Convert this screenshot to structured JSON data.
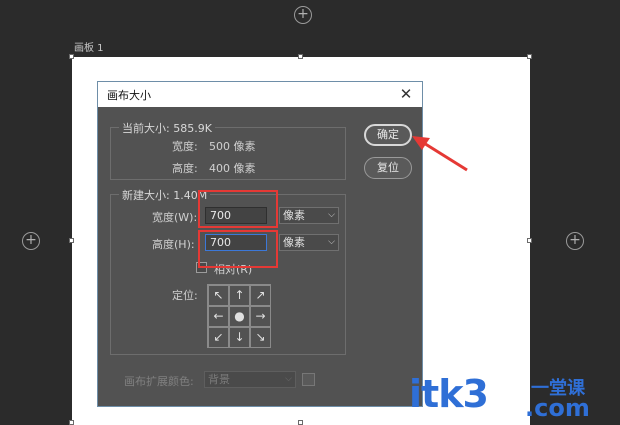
{
  "artboard": {
    "label": "画板 1"
  },
  "dialog": {
    "title": "画布大小",
    "close_glyph": "✕",
    "current_size": {
      "legend": "当前大小: 585.9K",
      "width_label": "宽度:",
      "width_value": "500 像素",
      "height_label": "高度:",
      "height_value": "400 像素"
    },
    "new_size": {
      "legend": "新建大小: 1.40M",
      "width_label": "宽度(W):",
      "width_value": "700",
      "width_unit": "像素",
      "height_label": "高度(H):",
      "height_value": "700",
      "height_unit": "像素",
      "relative_label": "相对(R)",
      "anchor_label": "定位:",
      "anchor_arrows": [
        "↖",
        "↑",
        "↗",
        "←",
        "●",
        "→",
        "↙",
        "↓",
        "↘"
      ]
    },
    "extension": {
      "label": "画布扩展颜色:",
      "value": "背景"
    },
    "buttons": {
      "ok": "确定",
      "reset": "复位"
    }
  },
  "watermark": {
    "brand": "itk3",
    "cn": "一堂课",
    "com": ".com"
  },
  "colors": {
    "highlight_box": "#e53935",
    "arrow": "#e53935",
    "watermark": "#2f6fd6"
  }
}
